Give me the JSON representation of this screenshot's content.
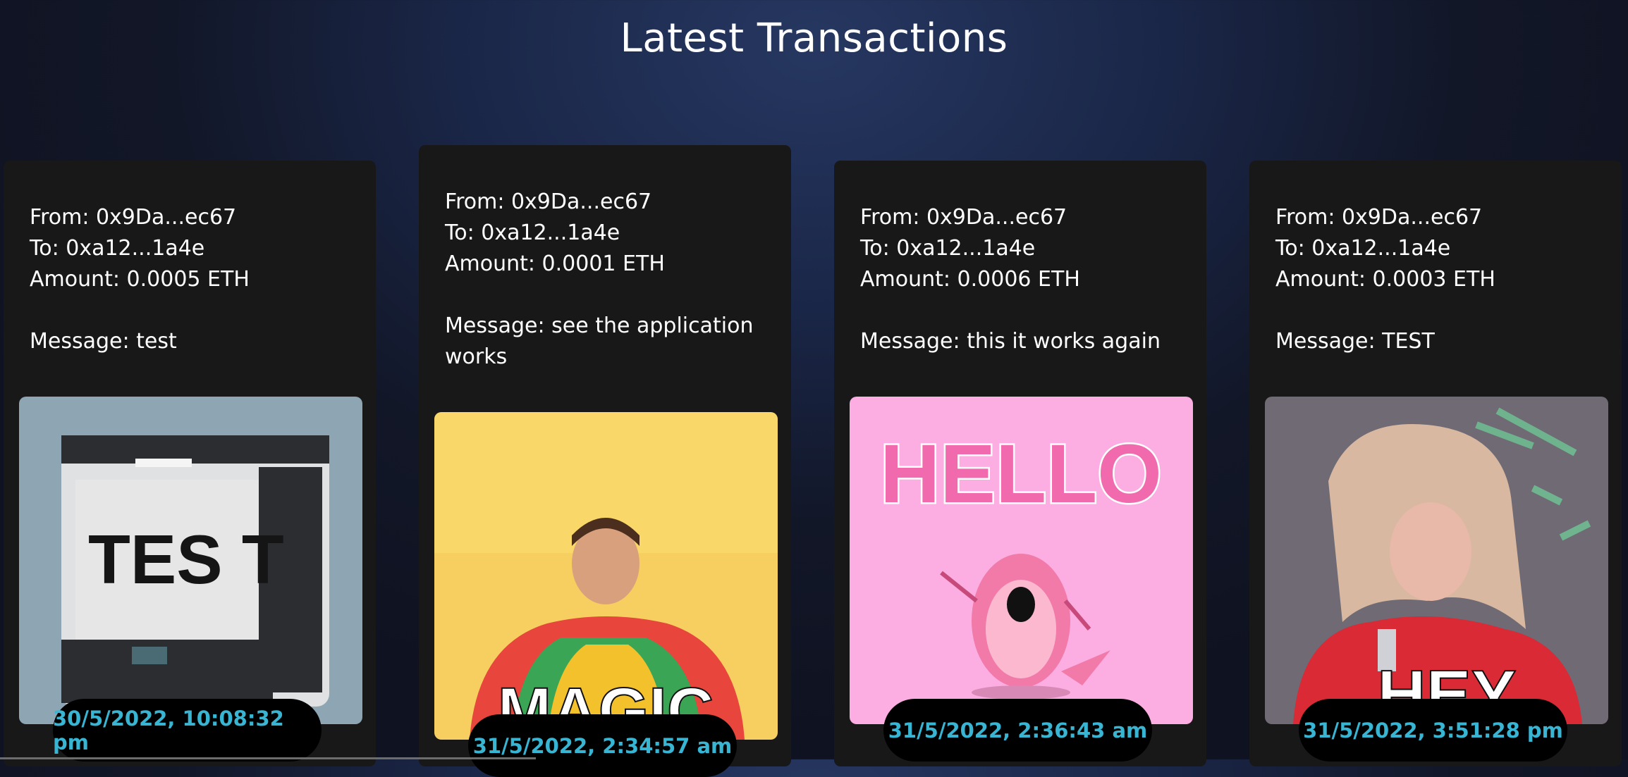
{
  "header": {
    "title": "Latest Transactions"
  },
  "transactions": [
    {
      "from": "From: 0x9Da...ec67",
      "to": "To: 0xa12...1a4e",
      "amount": "Amount: 0.0005 ETH",
      "message": "Message: test",
      "gif_text": "TES T",
      "timestamp": "30/5/2022, 10:08:32 pm"
    },
    {
      "from": "From: 0x9Da...ec67",
      "to": "To: 0xa12...1a4e",
      "amount": "Amount: 0.0001 ETH",
      "message": "Message: see the application works",
      "gif_text": "MAGIC",
      "timestamp": "31/5/2022, 2:34:57 am"
    },
    {
      "from": "From: 0x9Da...ec67",
      "to": "To: 0xa12...1a4e",
      "amount": "Amount: 0.0006 ETH",
      "message": "Message: this it works again",
      "gif_text": "HELLO",
      "timestamp": "31/5/2022, 2:36:43 am"
    },
    {
      "from": "From: 0x9Da...ec67",
      "to": "To: 0xa12...1a4e",
      "amount": "Amount: 0.0003 ETH",
      "message": "Message: TEST",
      "gif_text": "HEY",
      "timestamp": "31/5/2022, 3:51:28 pm"
    }
  ],
  "colors": {
    "accent": "#37b5d3",
    "card": "#181818"
  }
}
